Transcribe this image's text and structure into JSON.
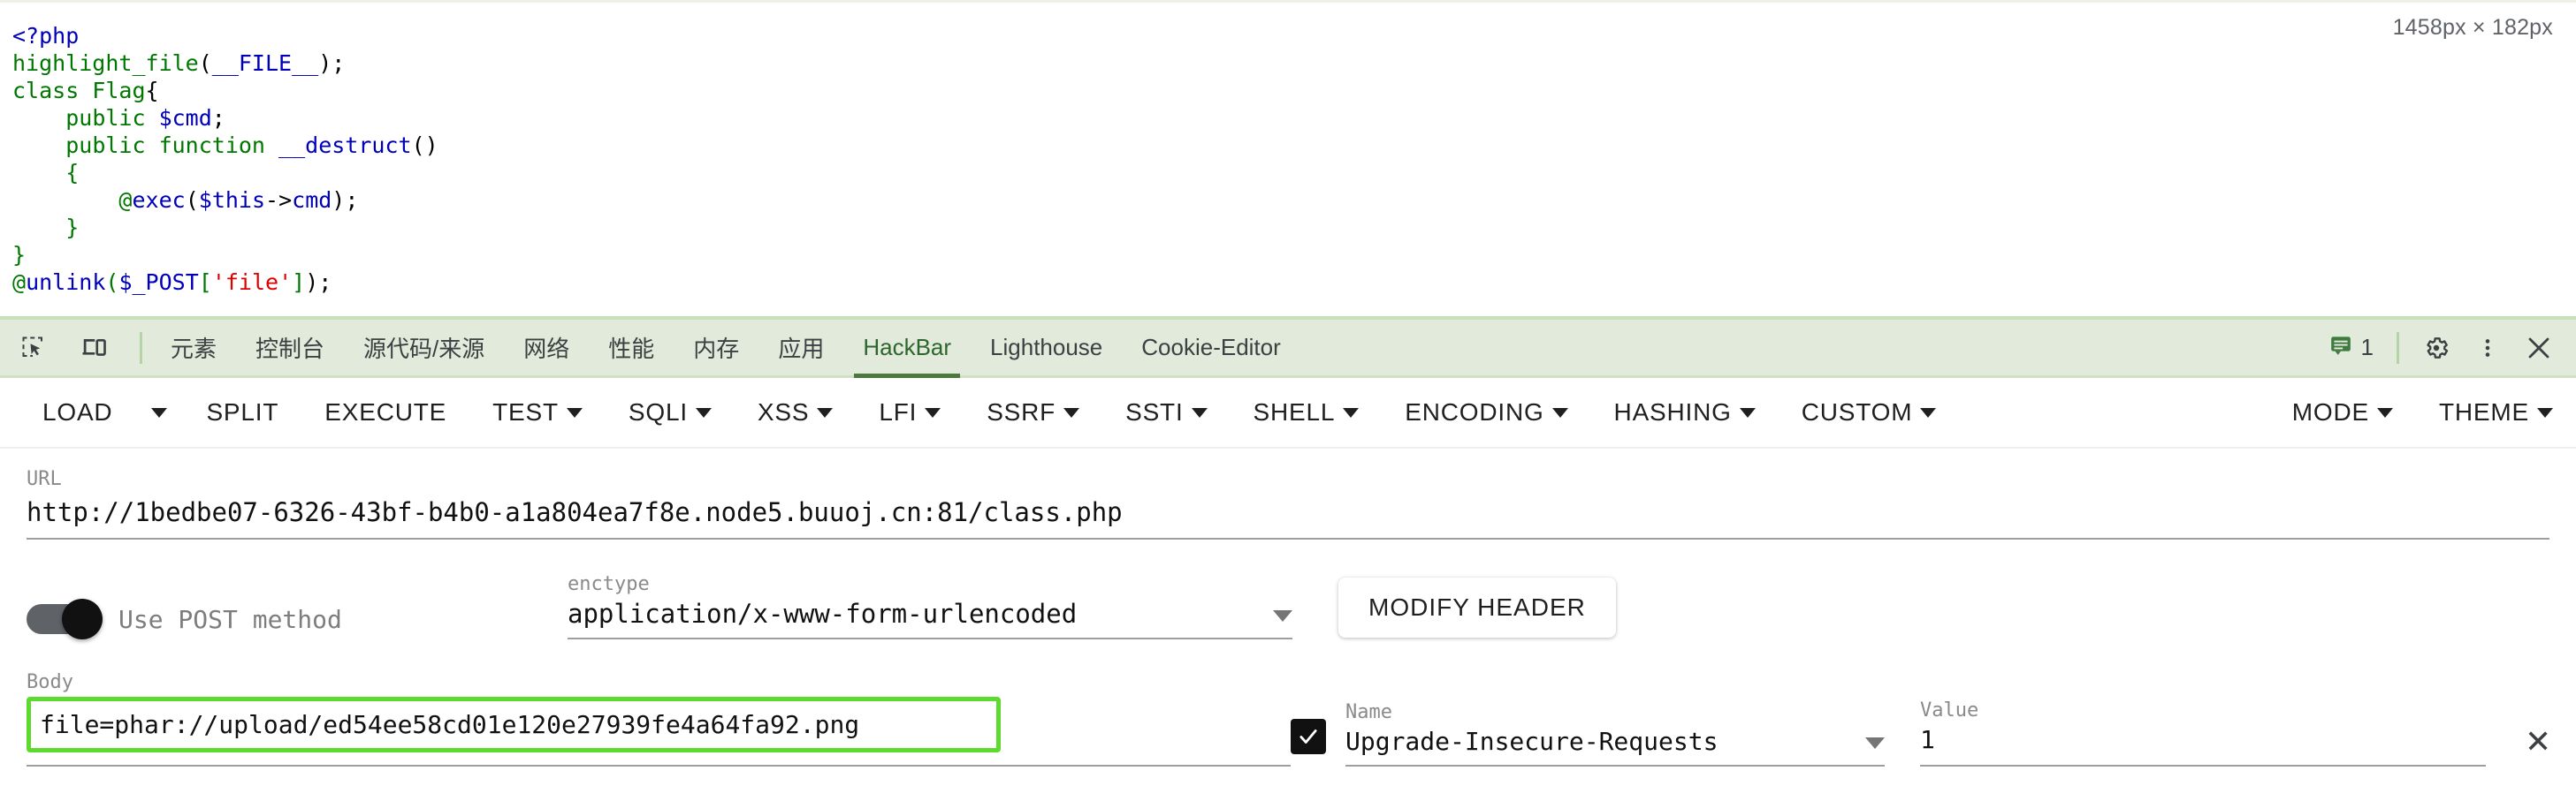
{
  "page": {
    "viewport_badge": "1458px × 182px",
    "code_lines": [
      [
        {
          "t": "<?php",
          "c": "blue"
        }
      ],
      [
        {
          "t": "highlight_file",
          "c": "green"
        },
        {
          "t": "(",
          "c": "gray"
        },
        {
          "t": "__FILE__",
          "c": "blue"
        },
        {
          "t": ");",
          "c": "gray"
        }
      ],
      [
        {
          "t": "class Flag",
          "c": "green"
        },
        {
          "t": "{",
          "c": "gray"
        }
      ],
      [
        {
          "t": "    ",
          "c": "gray"
        },
        {
          "t": "public ",
          "c": "green"
        },
        {
          "t": "$cmd",
          "c": "blue"
        },
        {
          "t": ";",
          "c": "gray"
        }
      ],
      [
        {
          "t": "    ",
          "c": "gray"
        },
        {
          "t": "public function ",
          "c": "green"
        },
        {
          "t": "__destruct",
          "c": "blue"
        },
        {
          "t": "()",
          "c": "gray"
        }
      ],
      [
        {
          "t": "    ",
          "c": "gray"
        },
        {
          "t": "{",
          "c": "green"
        }
      ],
      [
        {
          "t": "        ",
          "c": "gray"
        },
        {
          "t": "@",
          "c": "green"
        },
        {
          "t": "exec",
          "c": "blue"
        },
        {
          "t": "(",
          "c": "gray"
        },
        {
          "t": "$this",
          "c": "blue"
        },
        {
          "t": "->",
          "c": "gray"
        },
        {
          "t": "cmd",
          "c": "blue"
        },
        {
          "t": ");",
          "c": "gray"
        }
      ],
      [
        {
          "t": "    ",
          "c": "gray"
        },
        {
          "t": "}",
          "c": "green"
        }
      ],
      [
        {
          "t": "}",
          "c": "green"
        }
      ],
      [
        {
          "t": "@",
          "c": "green"
        },
        {
          "t": "unlink",
          "c": "blue"
        },
        {
          "t": "(",
          "c": "green"
        },
        {
          "t": "$_POST",
          "c": "blue"
        },
        {
          "t": "[",
          "c": "green"
        },
        {
          "t": "'file'",
          "c": "red"
        },
        {
          "t": "]",
          "c": "green"
        },
        {
          "t": ");",
          "c": "gray"
        }
      ]
    ]
  },
  "devtools": {
    "inspect_icon": "inspect-element-icon",
    "device_icon": "device-toolbar-icon",
    "tabs": [
      {
        "label": "元素",
        "active": false
      },
      {
        "label": "控制台",
        "active": false
      },
      {
        "label": "源代码/来源",
        "active": false
      },
      {
        "label": "网络",
        "active": false
      },
      {
        "label": "性能",
        "active": false
      },
      {
        "label": "内存",
        "active": false
      },
      {
        "label": "应用",
        "active": false
      },
      {
        "label": "HackBar",
        "active": true
      },
      {
        "label": "Lighthouse",
        "active": false
      },
      {
        "label": "Cookie-Editor",
        "active": false
      }
    ],
    "message_count": "1",
    "message_icon": "console-message-icon",
    "settings_icon": "gear-icon",
    "more_icon": "kebab-menu-icon",
    "close_icon": "close-icon",
    "accent_color": "#4c7a3e",
    "tabstrip_bg": "#e2eadb"
  },
  "hackbar": {
    "toolbar": [
      {
        "label": "LOAD",
        "caret": false,
        "separate_caret": true
      },
      {
        "label": "SPLIT",
        "caret": false,
        "separate_caret": false
      },
      {
        "label": "EXECUTE",
        "caret": false,
        "separate_caret": false
      },
      {
        "label": "TEST",
        "caret": true,
        "separate_caret": false
      },
      {
        "label": "SQLI",
        "caret": true,
        "separate_caret": false
      },
      {
        "label": "XSS",
        "caret": true,
        "separate_caret": false
      },
      {
        "label": "LFI",
        "caret": true,
        "separate_caret": false
      },
      {
        "label": "SSRF",
        "caret": true,
        "separate_caret": false
      },
      {
        "label": "SSTI",
        "caret": true,
        "separate_caret": false
      },
      {
        "label": "SHELL",
        "caret": true,
        "separate_caret": false
      },
      {
        "label": "ENCODING",
        "caret": true,
        "separate_caret": false
      },
      {
        "label": "HASHING",
        "caret": true,
        "separate_caret": false
      },
      {
        "label": "CUSTOM",
        "caret": true,
        "separate_caret": false
      }
    ],
    "toolbar_right": [
      {
        "label": "MODE",
        "caret": true
      },
      {
        "label": "THEME",
        "caret": true
      }
    ],
    "url": {
      "label": "URL",
      "value": "http://1bedbe07-6326-43bf-b4b0-a1a804ea7f8e.node5.buuoj.cn:81/class.php",
      "placeholder": "URL"
    },
    "post_toggle": {
      "label": "Use POST method",
      "enabled": true
    },
    "enctype": {
      "label": "enctype",
      "value": "application/x-www-form-urlencoded"
    },
    "modify_header_label": "MODIFY HEADER",
    "body": {
      "label": "Body",
      "value": "file=phar://upload/ed54ee58cd01e120e27939fe4a64fa92.png",
      "focus_color": "#5cdb2e"
    },
    "header_row": {
      "checked": true,
      "name_label": "Name",
      "name_value": "Upgrade-Insecure-Requests",
      "value_label": "Value",
      "value_value": "1",
      "remove_label": "✕"
    }
  }
}
